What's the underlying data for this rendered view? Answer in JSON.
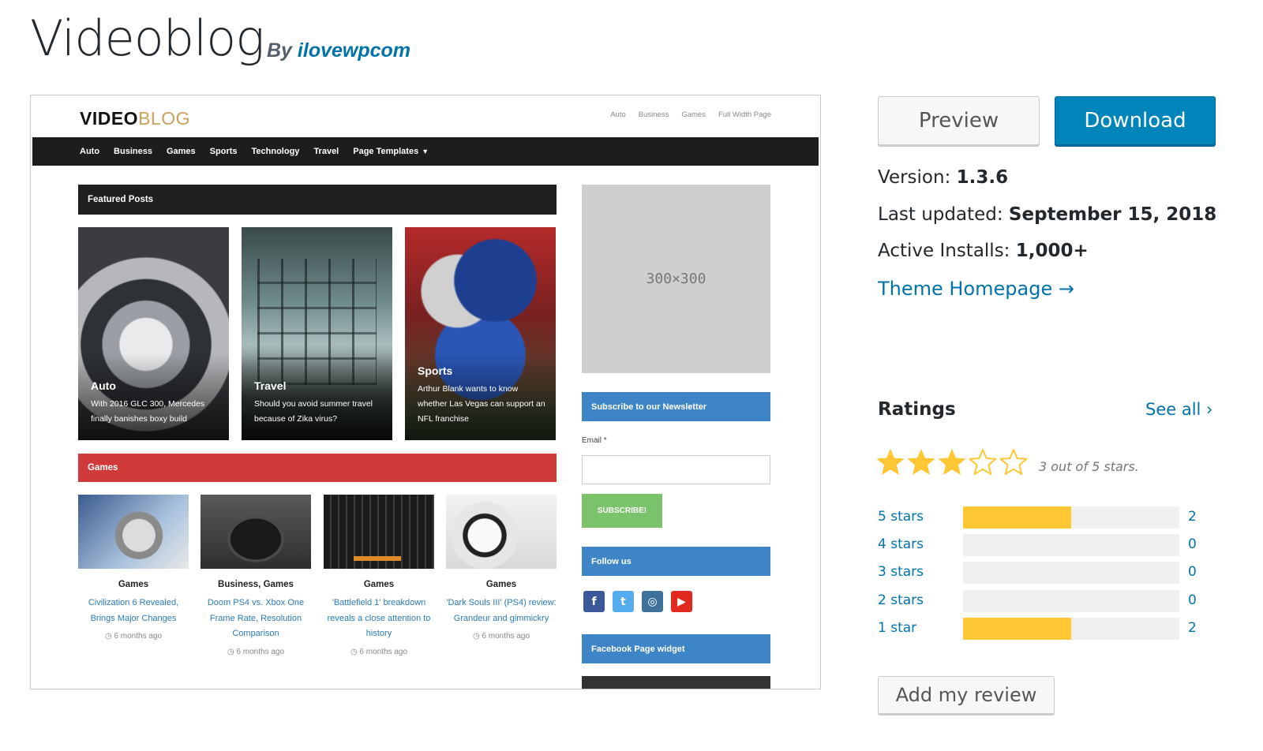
{
  "header": {
    "title": "Videoblog",
    "by_label": "By",
    "author": "ilovewpcom"
  },
  "screenshot": {
    "logo_primary": "VIDEO",
    "logo_secondary": "BLOG",
    "top_nav": [
      "Auto",
      "Business",
      "Games",
      "Full Width Page"
    ],
    "main_nav": [
      "Auto",
      "Business",
      "Games",
      "Sports",
      "Technology",
      "Travel",
      "Page Templates"
    ],
    "featured_label": "Featured Posts",
    "featured": [
      {
        "category": "Auto",
        "text": "With 2016 GLC 300, Mercedes finally banishes boxy build"
      },
      {
        "category": "Travel",
        "text": "Should you avoid summer travel because of Zika virus?"
      },
      {
        "category": "Sports",
        "text": "Arthur Blank wants to know whether Las Vegas can support an NFL franchise"
      }
    ],
    "games_label": "Games",
    "games": [
      {
        "category": "Games",
        "title": "Civilization 6 Revealed, Brings Major Changes",
        "time": "6 months ago"
      },
      {
        "category": "Business, Games",
        "title": "Doom PS4 vs. Xbox One Frame Rate, Resolution Comparison",
        "time": "6 months ago"
      },
      {
        "category": "Games",
        "title": "'Battlefield 1' breakdown reveals a close attention to history",
        "time": "6 months ago"
      },
      {
        "category": "Games",
        "title": "'Dark Souls III' (PS4) review: Grandeur and gimmickry",
        "time": "6 months ago"
      }
    ],
    "ad_placeholder": "300×300",
    "newsletter_title": "Subscribe to our Newsletter",
    "email_label": "Email *",
    "subscribe_label": "SUBSCRIBE!",
    "follow_title": "Follow us",
    "social": [
      "f",
      "t",
      "◎",
      "▶"
    ],
    "facebook_widget_title": "Facebook Page widget"
  },
  "actions": {
    "preview": "Preview",
    "download": "Download",
    "review": "Add my review"
  },
  "meta": {
    "version_label": "Version:",
    "version": "1.3.6",
    "updated_label": "Last updated:",
    "updated": "September 15, 2018",
    "installs_label": "Active Installs:",
    "installs": "1,000+",
    "homepage": "Theme Homepage →"
  },
  "ratings": {
    "title": "Ratings",
    "see_all": "See all ›",
    "stars_filled": 3,
    "stars_total": 5,
    "summary": "3 out of 5 stars.",
    "rows": [
      {
        "label": "5 stars",
        "count": "2",
        "fraction": 0.5
      },
      {
        "label": "4 stars",
        "count": "0",
        "fraction": 0
      },
      {
        "label": "3 stars",
        "count": "0",
        "fraction": 0
      },
      {
        "label": "2 stars",
        "count": "0",
        "fraction": 0
      },
      {
        "label": "1 star",
        "count": "2",
        "fraction": 0.5
      }
    ]
  },
  "colors": {
    "accent": "#0085ba",
    "link": "#0073aa",
    "star": "#ffc733",
    "games_bar": "#d13a3a",
    "widget_bar": "#3d85c6"
  }
}
